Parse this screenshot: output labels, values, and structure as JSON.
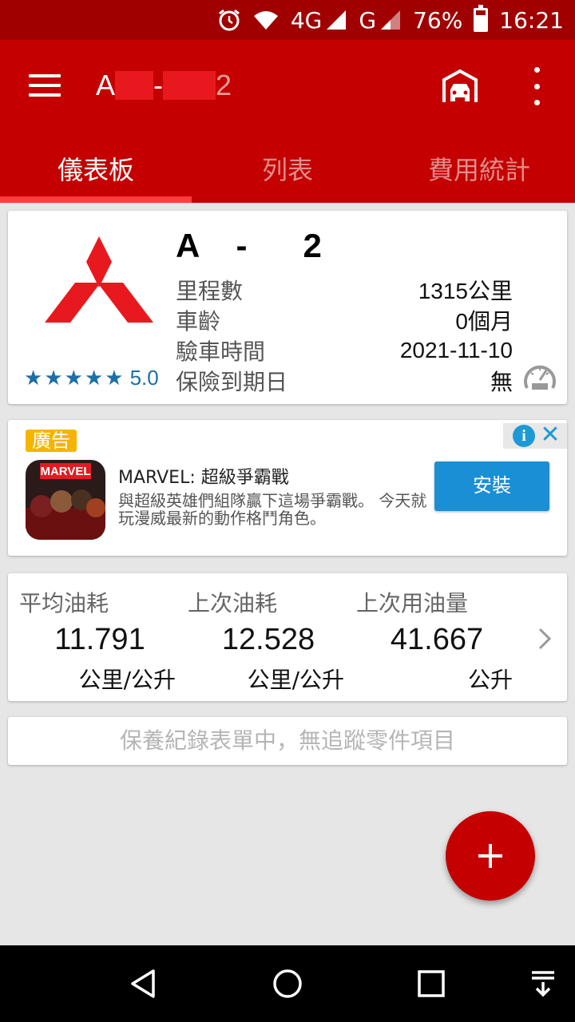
{
  "status_bar": {
    "network_4g": "4G",
    "network_g": "G",
    "battery": "76%",
    "battery_level": 0.76,
    "time": "16:21",
    "icons": [
      "alarm-icon",
      "wifi-icon",
      "signal-icon",
      "battery-icon"
    ]
  },
  "appbar": {
    "title_prefix": "A",
    "title_dash": "-",
    "title_suffix": "2",
    "icons": [
      "menu-icon",
      "garage-icon",
      "more-vert-icon"
    ]
  },
  "tabs": [
    {
      "label": "儀表板",
      "active": true
    },
    {
      "label": "列表",
      "active": false
    },
    {
      "label": "費用統計",
      "active": false
    }
  ],
  "vehicle": {
    "plate": "A    -      2",
    "rows": [
      {
        "label": "里程數",
        "value": "1315公里"
      },
      {
        "label": "車齡",
        "value": "0個月"
      },
      {
        "label": "驗車時間",
        "value": "2021-11-10"
      },
      {
        "label": "保險到期日",
        "value": "無"
      }
    ],
    "rating": "5.0",
    "stars": 5,
    "logo": "mitsubishi-logo"
  },
  "ad": {
    "badge": "廣告",
    "title": "MARVEL: 超級爭霸戰",
    "description": "與超級英雄們組隊贏下這場爭霸戰。 今天就玩漫威最新的動作格鬥角色。",
    "install_label": "安裝",
    "icon_label": "MARVEL"
  },
  "fuel": [
    {
      "label": "平均油耗",
      "value": "11.791",
      "unit": "公里/公升"
    },
    {
      "label": "上次油耗",
      "value": "12.528",
      "unit": "公里/公升"
    },
    {
      "label": "上次用油量",
      "value": "41.667",
      "unit": "公升"
    }
  ],
  "maintenance_text": "保養紀錄表單中，無追蹤零件項目",
  "colors": {
    "primary": "#c40000",
    "status_bar": "#a00000",
    "accent_blue": "#1d6fa5"
  }
}
